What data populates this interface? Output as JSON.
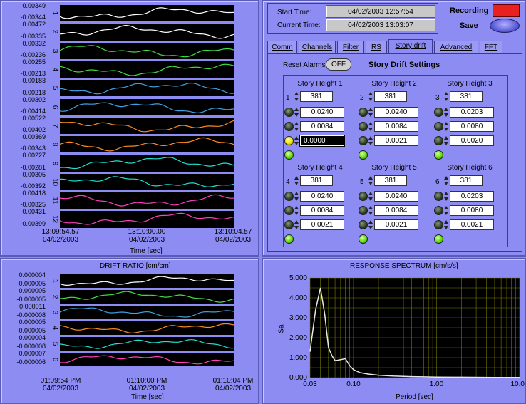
{
  "top_chart": {
    "channels": [
      "1",
      "2",
      "3",
      "4",
      "5",
      "6",
      "7",
      "8",
      "9",
      "10",
      "11",
      "12"
    ],
    "ylabels": [
      [
        "0.00349",
        "-0.00344"
      ],
      [
        "0.00472",
        "-0.00335"
      ],
      [
        "0.00332",
        "-0.00236"
      ],
      [
        "0.00255",
        "-0.00213"
      ],
      [
        "0.00183",
        "-0.00218"
      ],
      [
        "0.00302",
        "-0.00414"
      ],
      [
        "0.00522",
        "-0.00402"
      ],
      [
        "0.00369",
        "-0.00343"
      ],
      [
        "0.00227",
        "-0.00281"
      ],
      [
        "0.00305",
        "-0.00392"
      ],
      [
        "0.00418",
        "-0.00325"
      ],
      [
        "0.00431",
        "-0.00399"
      ]
    ],
    "colors": [
      "#ffffff",
      "#ffffff",
      "#40e040",
      "#40e040",
      "#40a0e0",
      "#40a0e0",
      "#ff8c20",
      "#ff8c20",
      "#20e0d0",
      "#20e0d0",
      "#ff40c0",
      "#ff40c0"
    ],
    "xticks": [
      [
        "13:09:54.57",
        "04/02/2003"
      ],
      [
        "13:10:00.00",
        "04/02/2003"
      ],
      [
        "13:10:04.57",
        "04/02/2003"
      ]
    ],
    "xlabel": "Time [sec]"
  },
  "drift_chart": {
    "title": "DRIFT RATIO [cm/cm]",
    "channels": [
      "1",
      "2",
      "3",
      "4",
      "5",
      "6"
    ],
    "ylabels": [
      [
        "0.000004",
        "-0.000005"
      ],
      [
        "0.000005",
        "-0.000005"
      ],
      [
        "0.000011",
        "-0.000008"
      ],
      [
        "0.000005",
        "-0.000005"
      ],
      [
        "0.000004",
        "-0.000008"
      ],
      [
        "0.000007",
        "-0.000006"
      ]
    ],
    "colors": [
      "#ffffff",
      "#40e040",
      "#40a0e0",
      "#ff8c20",
      "#20e0d0",
      "#ff40c0"
    ],
    "xticks": [
      [
        "01:09:54 PM",
        "04/02/2003"
      ],
      [
        "01:10:00 PM",
        "04/02/2003"
      ],
      [
        "01:10:04 PM",
        "04/02/2003"
      ]
    ],
    "xlabel": "Time [sec]"
  },
  "status": {
    "start_label": "Start Time:",
    "start_value": "04/02/2003  12:57:54",
    "current_label": "Current Time:",
    "current_value": "04/02/2003  13:03:07",
    "recording_label": "Recording",
    "save_label": "Save"
  },
  "tabs": [
    "Comm",
    "Channels",
    "Filter",
    "RS",
    "Story drift",
    "Advanced",
    "FFT"
  ],
  "active_tab": "Story drift",
  "story_drift": {
    "reset_label": "Reset Alarms",
    "reset_button": "OFF",
    "title": "Story Drift Settings",
    "groups": [
      {
        "label": "Story Height 1",
        "index": "1",
        "height": "381",
        "values": [
          "0.0240",
          "0.0084",
          "0.0000"
        ],
        "leds": [
          "off",
          "off",
          "yellow",
          "green"
        ]
      },
      {
        "label": "Story Height 2",
        "index": "2",
        "height": "381",
        "values": [
          "0.0240",
          "0.0084",
          "0.0021"
        ],
        "leds": [
          "off",
          "off",
          "off",
          "green"
        ]
      },
      {
        "label": "Story Height 3",
        "index": "3",
        "height": "381",
        "values": [
          "0.0203",
          "0.0080",
          "0.0020"
        ],
        "leds": [
          "off",
          "off",
          "off",
          "green"
        ]
      },
      {
        "label": "Story Height 4",
        "index": "4",
        "height": "381",
        "values": [
          "0.0240",
          "0.0084",
          "0.0021"
        ],
        "leds": [
          "off",
          "off",
          "off",
          "green"
        ]
      },
      {
        "label": "Story Height 5",
        "index": "5",
        "height": "381",
        "values": [
          "0.0240",
          "0.0084",
          "0.0021"
        ],
        "leds": [
          "off",
          "off",
          "off",
          "green"
        ]
      },
      {
        "label": "Story Height 6",
        "index": "6",
        "height": "381",
        "values": [
          "0.0203",
          "0.0080",
          "0.0021"
        ],
        "leds": [
          "off",
          "off",
          "off",
          "green"
        ]
      }
    ]
  },
  "chart_data": {
    "type": "line",
    "title": "RESPONSE SPECTRUM [cm/s/s]",
    "xlabel": "Period [sec]",
    "ylabel": "Sa",
    "xscale": "log",
    "xlim": [
      0.03,
      10
    ],
    "ylim": [
      0,
      5
    ],
    "xticks": [
      "0.03",
      "0.10",
      "1.00",
      "10.00"
    ],
    "yticks": [
      "0.000",
      "1.000",
      "2.000",
      "3.000",
      "4.000",
      "5.000"
    ],
    "grid": true,
    "series": [
      {
        "color": "#e8e8e8",
        "x": [
          0.03,
          0.035,
          0.04,
          0.045,
          0.05,
          0.055,
          0.06,
          0.07,
          0.08,
          0.09,
          0.1,
          0.12,
          0.15,
          0.2,
          0.3,
          0.5,
          0.7,
          1,
          2,
          5,
          10
        ],
        "y": [
          1.3,
          3.4,
          4.5,
          3.2,
          1.5,
          1.1,
          0.85,
          0.9,
          0.95,
          0.6,
          0.4,
          0.25,
          0.18,
          0.12,
          0.08,
          0.05,
          0.04,
          0.03,
          0.02,
          0.01,
          0.01
        ]
      }
    ]
  }
}
